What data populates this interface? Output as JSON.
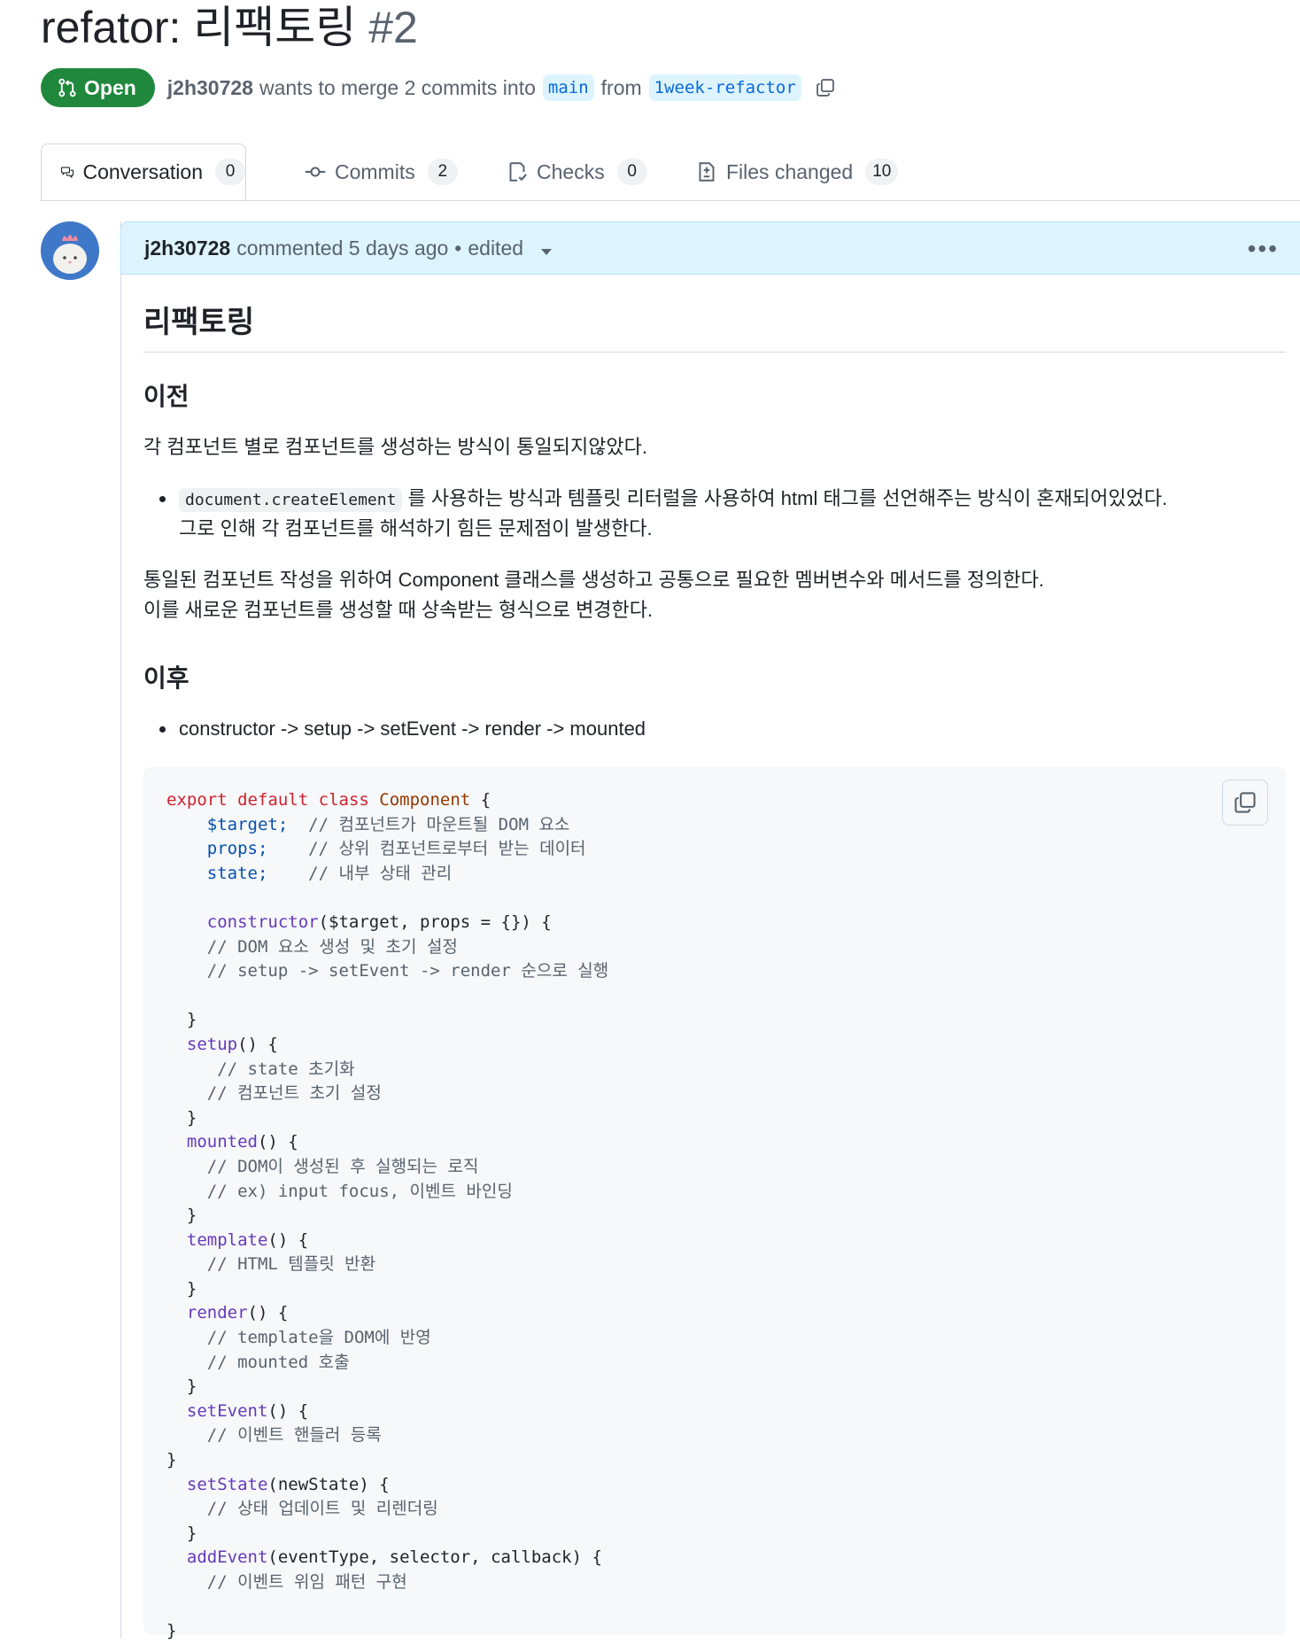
{
  "pr": {
    "title": "refator: 리팩토링",
    "number": "#2",
    "status": "Open",
    "author": "j2h30728",
    "merge_text": "wants to merge 2 commits into",
    "base_branch": "main",
    "from_text": "from",
    "head_branch": "1week-refactor"
  },
  "tabs": [
    {
      "label": "Conversation",
      "count": "0",
      "icon": "comment-discussion-icon"
    },
    {
      "label": "Commits",
      "count": "2",
      "icon": "git-commit-icon"
    },
    {
      "label": "Checks",
      "count": "0",
      "icon": "checklist-icon"
    },
    {
      "label": "Files changed",
      "count": "10",
      "icon": "file-diff-icon"
    }
  ],
  "comment": {
    "author": "j2h30728",
    "action": "commented 5 days ago",
    "edited": "edited",
    "menu_icon": "kebab-horizontal-icon"
  },
  "content": {
    "h1": "리팩토링",
    "before_heading": "이전",
    "before_para": "각 컴포넌트 별로 컴포넌트를 생성하는 방식이 통일되지않았다.",
    "before_code": "document.createElement",
    "before_bullet_1": "를 사용하는 방식과 템플릿 리터럴을 사용하여 html 태그를 선언해주는 방식이 혼재되어있었다.",
    "before_bullet_2": "그로 인해 각 컴포넌트를 해석하기 힘든 문제점이 발생한다.",
    "para2_line1": "통일된 컴포넌트 작성을 위하여 Component 클래스를 생성하고 공통으로 필요한 멤버변수와 메서드를 정의한다.",
    "para2_line2": "이를 새로운 컴포넌트를 생성할 때 상속받는 형식으로 변경한다.",
    "after_heading": "이후",
    "after_bullet": "constructor -> setup -> setEvent -> render -> mounted"
  },
  "code": {
    "l1": [
      "export",
      "default",
      "class",
      "Component",
      "{"
    ],
    "target": "$target;",
    "target_cm": "// 컴포넌트가 마운트될 DOM 요소",
    "props": "props;",
    "props_cm": "// 상위 컴포넌트로부터 받는 데이터",
    "state": "state;",
    "state_cm": "// 내부 상태 관리",
    "ctor_fn": "constructor",
    "ctor_args": "($target, props = {}) {",
    "ctor_cm1": "// DOM 요소 생성 및 초기 설정",
    "ctor_cm2": "// setup -> setEvent -> render 순으로 실행",
    "close": "}",
    "setup_fn": "setup",
    "paren_open": "() {",
    "setup_cm1": "// state 초기화",
    "setup_cm2": "// 컴포넌트 초기 설정",
    "mounted_fn": "mounted",
    "mounted_cm1": "// DOM이 생성된 후 실행되는 로직",
    "mounted_cm2": "// ex) input focus, 이벤트 바인딩",
    "template_fn": "template",
    "template_cm": "// HTML 템플릿 반환",
    "render_fn": "render",
    "render_cm1": "// template을 DOM에 반영",
    "render_cm2": "// mounted 호출",
    "setEvent_fn": "setEvent",
    "setEvent_cm": "// 이벤트 핸들러 등록",
    "setState_fn": "setState",
    "setState_args": "(newState) {",
    "setState_cm": "// 상태 업데이트 및 리렌더링",
    "addEvent_fn": "addEvent",
    "addEvent_args": "(eventType, selector, callback) {",
    "addEvent_cm": "// 이벤트 위임 패턴 구현"
  },
  "colors": {
    "open_green": "#1f883d",
    "header_blue": "#ddf4ff",
    "link_blue": "#0969da"
  }
}
